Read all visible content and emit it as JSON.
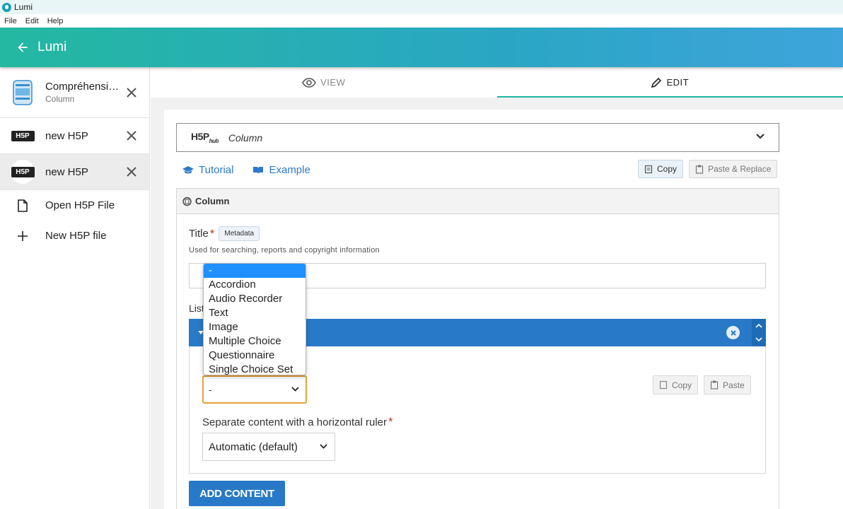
{
  "window": {
    "title": "Lumi"
  },
  "menubar": {
    "items": [
      "File",
      "Edit",
      "Help"
    ]
  },
  "header": {
    "title": "Lumi"
  },
  "sidebar": {
    "items": [
      {
        "title": "Compréhensi…",
        "subtitle": "Column",
        "thumb": "h5p-content-thumbnail"
      },
      {
        "title": "new H5P",
        "thumb": "h5p-logo",
        "logo_text": "H5P"
      },
      {
        "title": "new H5P",
        "thumb": "h5p-logo",
        "logo_text": "H5P",
        "active": true
      }
    ],
    "actions": [
      {
        "label": "Open H5P File",
        "icon": "file-icon"
      },
      {
        "label": "New H5P file",
        "icon": "plus-icon"
      }
    ]
  },
  "tabs": [
    {
      "label": "VIEW",
      "icon": "eye-icon"
    },
    {
      "label": "EDIT",
      "icon": "pencil-icon",
      "active": true
    }
  ],
  "hub": {
    "logo": "H5P",
    "logo_sub": "hub",
    "content_type": "Column"
  },
  "links": {
    "tutorial": "Tutorial",
    "example": "Example"
  },
  "buttons": {
    "copy": "Copy",
    "paste_replace": "Paste & Replace",
    "copy_inner": "Copy",
    "paste_inner": "Paste",
    "add_content": "ADD CONTENT"
  },
  "group": {
    "title": "Column"
  },
  "title_field": {
    "label": "Title",
    "required_mark": "*",
    "metadata_button": "Metadata",
    "description": "Used for searching, reports and copyright information",
    "value": ""
  },
  "list": {
    "label": "List"
  },
  "library_select": {
    "value": "-",
    "options": [
      "-",
      "Accordion",
      "Audio Recorder",
      "Text",
      "Image",
      "Multiple Choice",
      "Questionnaire",
      "Single Choice Set"
    ]
  },
  "separator_field": {
    "label": "Separate content with a horizontal ruler",
    "required_mark": "*",
    "value": "Automatic (default)"
  },
  "colors": {
    "accent_teal": "#21b3a0",
    "primary_blue": "#2879c7",
    "focus_orange": "#e6a136",
    "dropdown_highlight": "#1e90ff"
  }
}
